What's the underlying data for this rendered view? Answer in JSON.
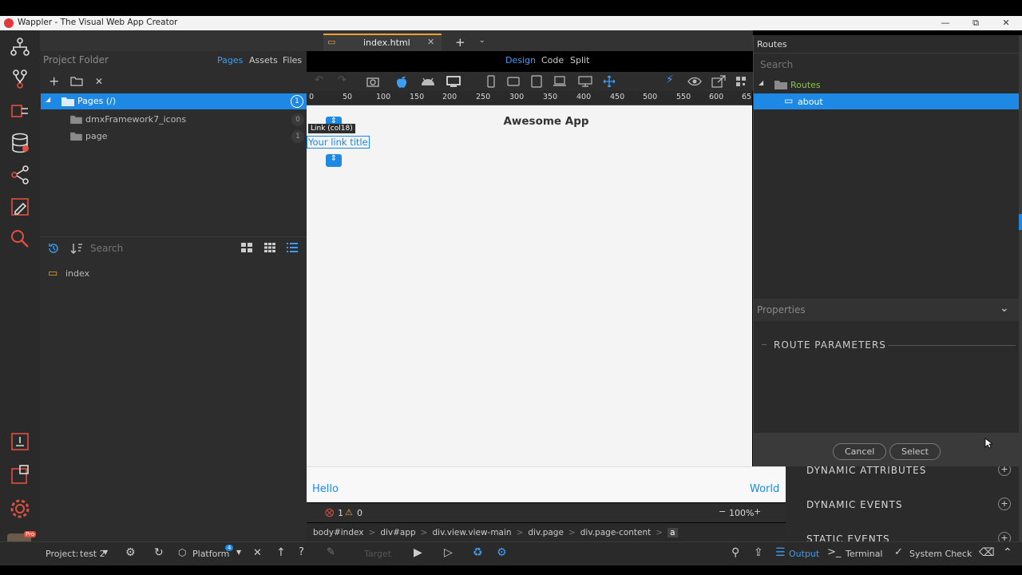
{
  "window": {
    "title": "Wappler - The Visual Web App Creator"
  },
  "doc_tab": {
    "name": "index.html"
  },
  "left_panel": {
    "title": "Project Folder",
    "tabs": [
      "Pages",
      "Assets",
      "Files"
    ],
    "tree": [
      {
        "label": "Pages (/)",
        "badge": "1"
      },
      {
        "label": "dmxFramework7_icons",
        "badge": "0"
      },
      {
        "label": "page",
        "badge": "1"
      }
    ],
    "search_placeholder": "Search",
    "files": [
      "index"
    ]
  },
  "view_tabs": [
    "Design",
    "Code",
    "Split"
  ],
  "ruler": [
    "0",
    "50",
    "100",
    "150",
    "200",
    "250",
    "300",
    "350",
    "400",
    "450",
    "500",
    "550",
    "600",
    "65"
  ],
  "canvas": {
    "app_title": "Awesome App",
    "link_tooltip": "Link (col18)",
    "link_text": "Your link title",
    "toolbar_left": "Hello",
    "toolbar_right": "World"
  },
  "status_inline": {
    "errors": "1",
    "warnings": "0",
    "zoom": "100%"
  },
  "breadcrumb": [
    "body#index",
    "div#app",
    "div.view.view-main",
    "div.page",
    "div.page-content",
    "a"
  ],
  "routes_panel": {
    "title": "Routes",
    "search_placeholder": "Search",
    "tree": [
      "Routes",
      "about"
    ],
    "properties_label": "Properties",
    "route_parameters": "ROUTE PARAMETERS",
    "cancel": "Cancel",
    "select": "Select"
  },
  "props_sections": [
    "DYNAMIC ATTRIBUTES",
    "DYNAMIC EVENTS",
    "STATIC EVENTS"
  ],
  "statusbar": {
    "project": "Project:",
    "project_name": "test 2",
    "platform": "Platform",
    "platform_badge": "4",
    "target": "Target",
    "output": "Output",
    "terminal": "Terminal",
    "system_check": "System Check",
    "pro_badge": "Pro"
  },
  "colors": {
    "accent": "#1e88e5",
    "folder": "#e8b84a",
    "html_icon": "#f0a030"
  }
}
